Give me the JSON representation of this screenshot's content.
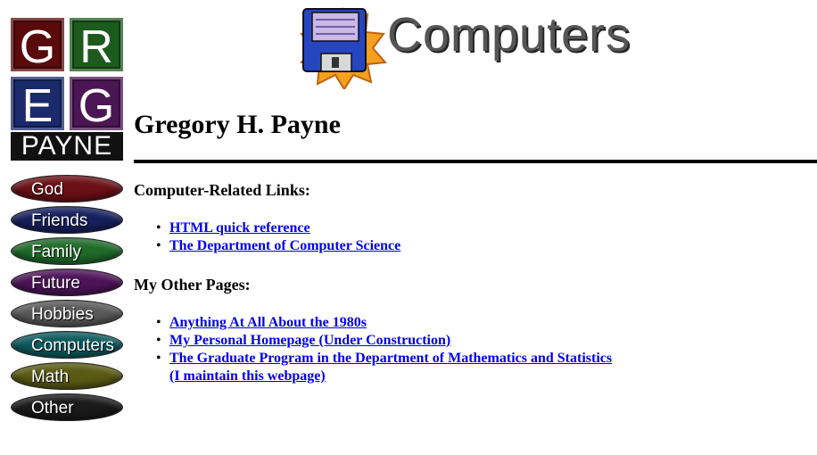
{
  "logo": {
    "letters": [
      "G",
      "R",
      "E",
      "G"
    ],
    "bottom": "PAYNE"
  },
  "header": {
    "logo_text": "Computers",
    "logo_icon": "floppy-disk-icon"
  },
  "page": {
    "title": "Gregory H. Payne"
  },
  "nav": [
    {
      "label": "God",
      "color": "#6b1016"
    },
    {
      "label": "Friends",
      "color": "#16205e"
    },
    {
      "label": "Family",
      "color": "#1f6b2a"
    },
    {
      "label": "Future",
      "color": "#4e1459"
    },
    {
      "label": "Hobbies",
      "color": "#5a5a5a"
    },
    {
      "label": "Computers",
      "color": "#0e5a5e"
    },
    {
      "label": "Math",
      "color": "#5a5a14"
    },
    {
      "label": "Other",
      "color": "#1a1a1a"
    }
  ],
  "sections": {
    "computer_links": {
      "heading": "Computer-Related Links:",
      "items": [
        "HTML quick reference",
        "The Department of Computer Science"
      ]
    },
    "other_pages": {
      "heading": "My Other Pages:",
      "items": [
        "Anything At All About the 1980s",
        "My Personal Homepage (Under Construction)",
        "The Graduate Program in the Department of Mathematics and Statistics",
        "(I maintain this webpage)"
      ]
    }
  }
}
